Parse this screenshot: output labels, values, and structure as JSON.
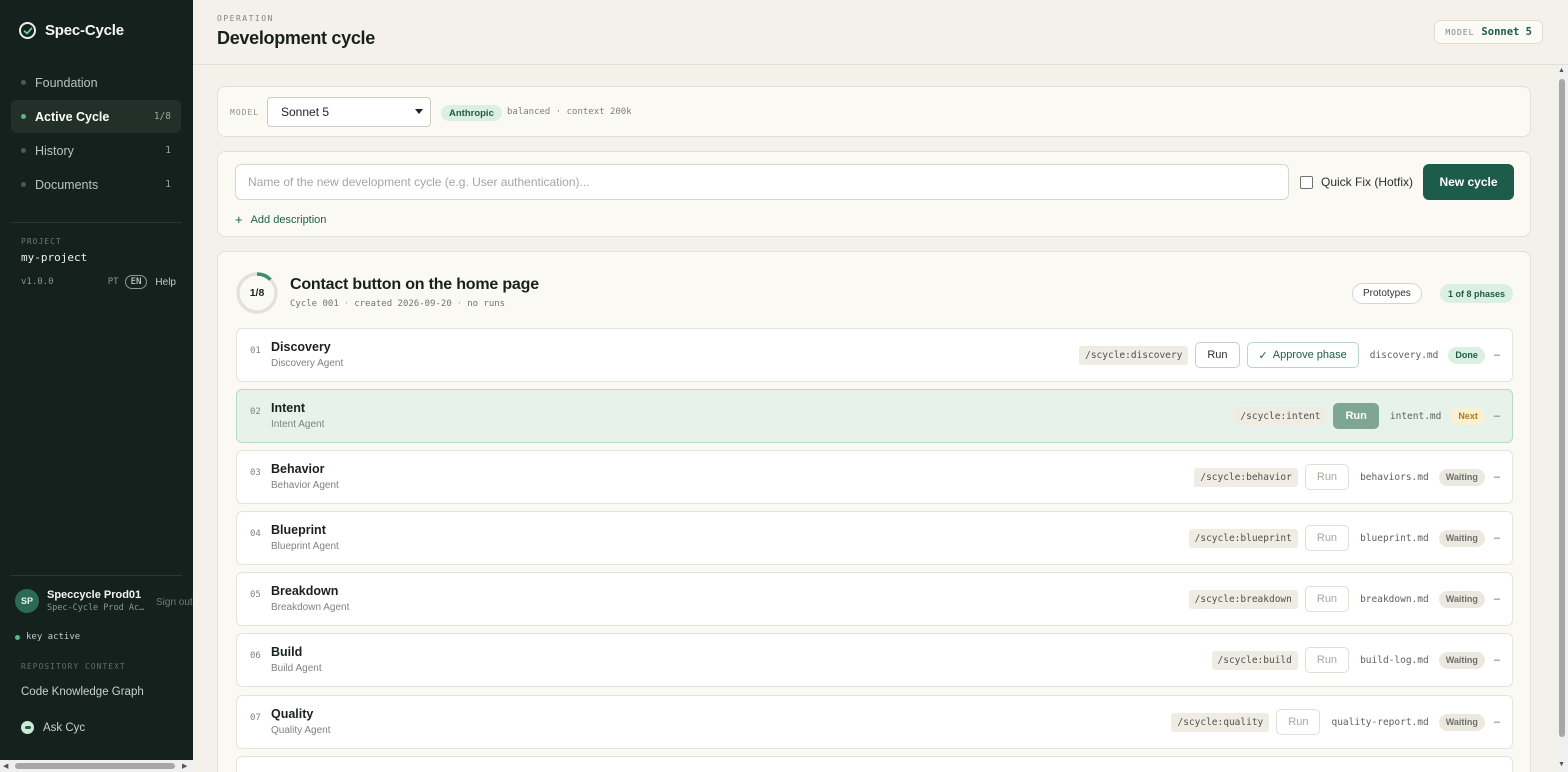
{
  "app": {
    "name": "Spec-Cycle"
  },
  "sidebar": {
    "items": [
      {
        "label": "Foundation",
        "count": ""
      },
      {
        "label": "Active Cycle",
        "count": "1/8"
      },
      {
        "label": "History",
        "count": "1"
      },
      {
        "label": "Documents",
        "count": "1"
      }
    ],
    "project_caption": "PROJECT",
    "project_name": "my-project",
    "version": "v1.0.0",
    "lang_pt": "PT",
    "lang_en": "EN",
    "help": "Help",
    "user": {
      "initials": "SP",
      "name": "Speccycle Prod01",
      "org": "Spec-Cycle Prod Ac…",
      "sign_out": "Sign out"
    },
    "key_status": "key active",
    "repo_caption": "REPOSITORY CONTEXT",
    "code_graph": "Code Knowledge Graph",
    "ask": "Ask Cyc"
  },
  "header": {
    "caption": "OPERATION",
    "title": "Development cycle",
    "model_caption": "MODEL",
    "model_value": "Sonnet 5"
  },
  "model_card": {
    "caption": "MODEL",
    "selected": "Sonnet 5",
    "provider": "Anthropic",
    "meta": "balanced · context 200k"
  },
  "new_cycle": {
    "placeholder": "Name of the new development cycle (e.g. User authentication)...",
    "value": "",
    "quick_fix_label": "Quick Fix (Hotfix)",
    "quick_fix_checked": false,
    "button": "New cycle",
    "add_description": "Add description"
  },
  "cycle": {
    "progress_label": "1/8",
    "progress_fraction": 0.125,
    "title": "Contact button on the home page",
    "meta_id": "Cycle 001",
    "meta_created": "created 2026-09-20",
    "meta_runs": "no runs",
    "prototypes_button": "Prototypes",
    "phase_count": "1 of 8 phases",
    "phases": [
      {
        "num": "01",
        "name": "Discovery",
        "agent": "Discovery Agent",
        "cmd": "/scycle:discovery",
        "run": "Run",
        "approve": "Approve phase",
        "file": "discovery.md",
        "status": "Done",
        "dash": "–"
      },
      {
        "num": "02",
        "name": "Intent",
        "agent": "Intent Agent",
        "cmd": "/scycle:intent",
        "run": "Run",
        "file": "intent.md",
        "status": "Next",
        "dash": "–"
      },
      {
        "num": "03",
        "name": "Behavior",
        "agent": "Behavior Agent",
        "cmd": "/scycle:behavior",
        "run": "Run",
        "file": "behaviors.md",
        "status": "Waiting",
        "dash": "–"
      },
      {
        "num": "04",
        "name": "Blueprint",
        "agent": "Blueprint Agent",
        "cmd": "/scycle:blueprint",
        "run": "Run",
        "file": "blueprint.md",
        "status": "Waiting",
        "dash": "–"
      },
      {
        "num": "05",
        "name": "Breakdown",
        "agent": "Breakdown Agent",
        "cmd": "/scycle:breakdown",
        "run": "Run",
        "file": "breakdown.md",
        "status": "Waiting",
        "dash": "–"
      },
      {
        "num": "06",
        "name": "Build",
        "agent": "Build Agent",
        "cmd": "/scycle:build",
        "run": "Run",
        "file": "build-log.md",
        "status": "Waiting",
        "dash": "–"
      },
      {
        "num": "07",
        "name": "Quality",
        "agent": "Quality Agent",
        "cmd": "/scycle:quality",
        "run": "Run",
        "file": "quality-report.md",
        "status": "Waiting",
        "dash": "–"
      }
    ]
  },
  "colors": {
    "sidebar_bg": "#14211d",
    "accent": "#1d5c4a",
    "done": "#dcefe3",
    "next": "#fbf0d2",
    "waiting": "#ebe8e0"
  }
}
